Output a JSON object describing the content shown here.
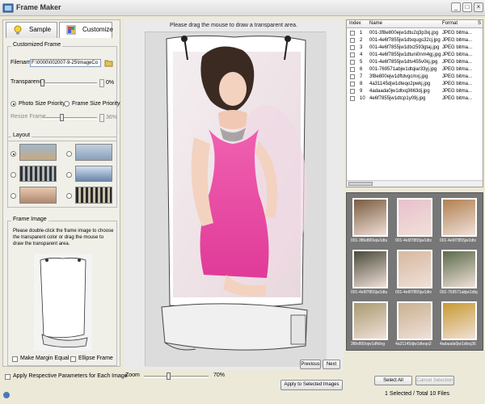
{
  "window": {
    "title": "Frame Maker"
  },
  "tabs": [
    {
      "label": "Sample"
    },
    {
      "label": "Customize"
    }
  ],
  "customized_frame": {
    "group_title": "Customized Frame",
    "filename_label": "Filename",
    "filename_value": "F:\\0000\\002007-9-25\\ImageCo",
    "transparence_label": "Transparence",
    "transparence_value": "0%",
    "transparence_percent": 0,
    "photo_size_priority": "Photo Size Priority",
    "frame_size_priority": "Frame Size Priority",
    "resize_frame_label": "Resize Frame",
    "resize_frame_value": "36%",
    "resize_frame_percent": 36
  },
  "layout": {
    "group_title": "Layout",
    "selected_index": 0
  },
  "frame_image": {
    "group_title": "Frame Image",
    "instructions": "Please double-click the frame image to choose the transparent color or drag the mouse to draw the transparent area.",
    "make_margin_equal": "Make Margin Equal",
    "ellipse_frame": "Ellipse Frame"
  },
  "apply_each_label": "Apply Respective Parameters for Each Image",
  "preview": {
    "hint": "Please drag the mouse to draw a transparent area.",
    "previous_label": "Previous",
    "next_label": "Next",
    "zoom_label": "Zoom",
    "zoom_value": "70%",
    "zoom_percent": 70,
    "apply_selected_label": "Apply to Selected Images"
  },
  "file_list": {
    "columns": [
      "Index",
      "Name",
      "Format",
      "S"
    ],
    "rows": [
      {
        "index": "1",
        "name": "001-3f8e800ejw1dtu2q3p3xj.jpg",
        "format": "JPEG bitma..."
      },
      {
        "index": "2",
        "name": "001-4e6f7855jw1dtxqugs32cj.jpg",
        "format": "JPEG bitma..."
      },
      {
        "index": "3",
        "name": "001-4e6f7855jw1dtxz593gtaj.jpg",
        "format": "JPEG bitma..."
      },
      {
        "index": "4",
        "name": "001-4e6f7855jw1dtuni0nm4gj.jpg",
        "format": "JPEG bitma..."
      },
      {
        "index": "5",
        "name": "001-4e6f7855jw1dtv455v0kj.jpg",
        "format": "JPEG bitma..."
      },
      {
        "index": "6",
        "name": "001-769571abjw1dtqiar33yj.jpg",
        "format": "JPEG bitma..."
      },
      {
        "index": "7",
        "name": "3f8e800ejw1dftdvgcmxj.jpg",
        "format": "JPEG bitma..."
      },
      {
        "index": "8",
        "name": "4a31145djw1dteqo2pwkj.jpg",
        "format": "JPEG bitma..."
      },
      {
        "index": "9",
        "name": "4adaada0jw1dtxq3663dj.jpg",
        "format": "JPEG bitma..."
      },
      {
        "index": "10",
        "name": "4e6f7855jw1dtcp1y09j.jpg",
        "format": "JPEG bitma..."
      }
    ]
  },
  "thumbnails": [
    {
      "caption": "001-3f8e800ejw1dtu",
      "color": "#7a5b3e"
    },
    {
      "caption": "001-4e6f7855jw1dtx",
      "color": "#e8c0cc"
    },
    {
      "caption": "001-4e6f7855jw1dtx",
      "color": "#b08050"
    },
    {
      "caption": "001-4e6f7855jw1dtu",
      "color": "#4a4a3a"
    },
    {
      "caption": "001-4e6f7855jw1dtv",
      "color": "#d6b8a0"
    },
    {
      "caption": "001-769571abjw1dtq",
      "color": "#5a6a4a"
    },
    {
      "caption": "3f8e800ejw1dftdvg",
      "color": "#a89a70"
    },
    {
      "caption": "4a31145djw1dteqo2",
      "color": "#c8b090"
    },
    {
      "caption": "4adaada0jw1dtxq36",
      "color": "#c89a30"
    }
  ],
  "bottom": {
    "select_all_label": "Select All",
    "cancel_selection_label": "Cancel Selection",
    "status": "1 Selected / Total 10 Files"
  }
}
